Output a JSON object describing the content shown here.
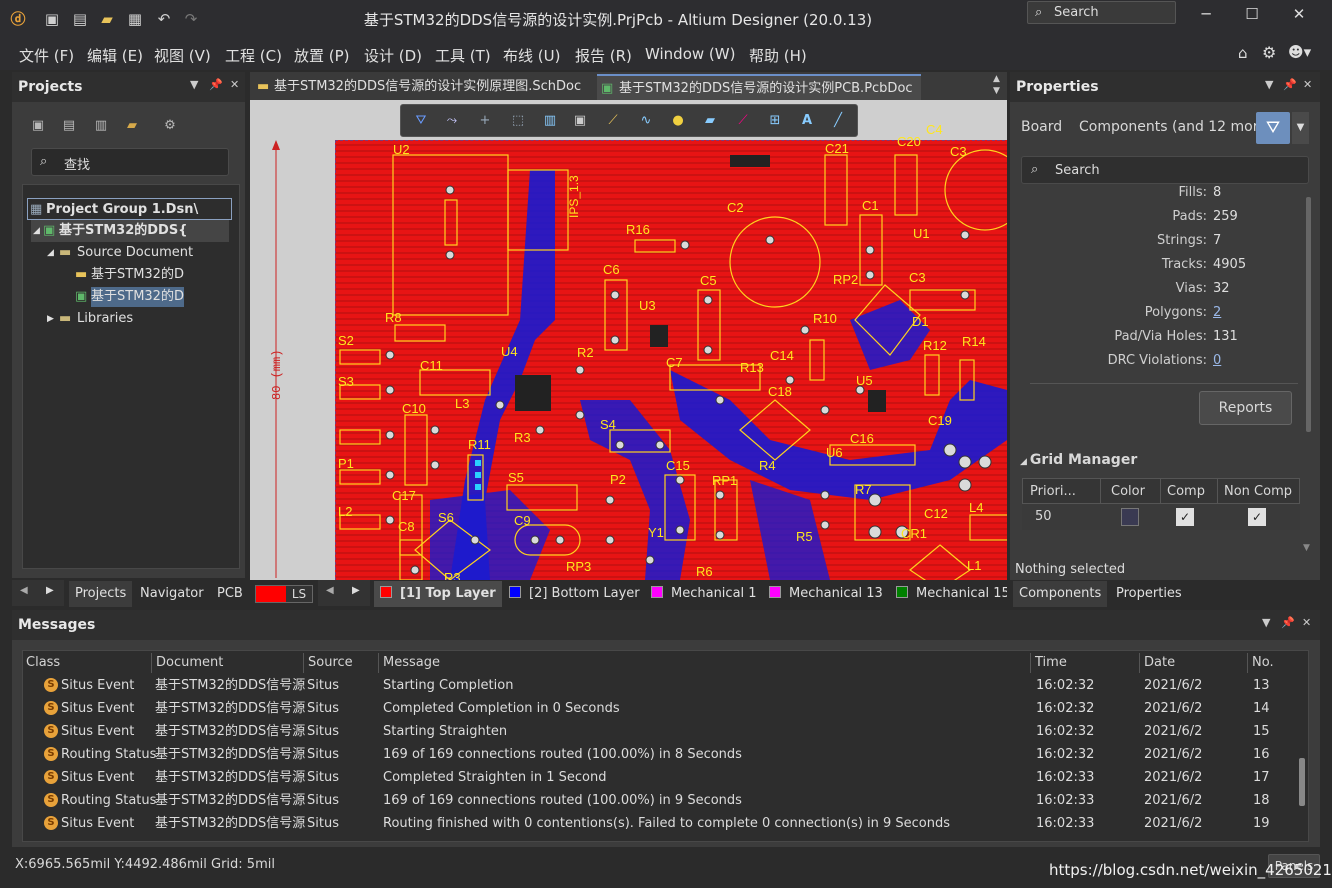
{
  "window": {
    "title": "基于STM32的DDS信号源的设计实例.PrjPcb - Altium Designer (20.0.13)",
    "search_placeholder": "Search",
    "minimize": "─",
    "maximize": "☐",
    "close": "✕"
  },
  "menu": [
    "文件 (F)",
    "编辑 (E)",
    "视图 (V)",
    "工程 (C)",
    "放置 (P)",
    "设计 (D)",
    "工具 (T)",
    "布线 (U)",
    "报告 (R)",
    "Window (W)",
    "帮助 (H)"
  ],
  "projects_panel": {
    "title": "Projects",
    "search_placeholder": "查找",
    "tree": [
      {
        "label": "Project Group 1.Dsn\\",
        "level": 0,
        "icon": "project-group-icon"
      },
      {
        "label": "基于STM32的DDS{",
        "level": 1,
        "icon": "pcb-project-icon"
      },
      {
        "label": "Source Document",
        "level": 2,
        "icon": "folder-icon"
      },
      {
        "label": "基于STM32的D",
        "level": 3,
        "icon": "schematic-doc-icon"
      },
      {
        "label": "基于STM32的D",
        "level": 3,
        "icon": "pcb-doc-icon"
      },
      {
        "label": "Libraries",
        "level": 2,
        "icon": "folder-icon"
      }
    ],
    "bottom_tabs": [
      "Projects",
      "Navigator",
      "PCB",
      "LS"
    ]
  },
  "documents": {
    "tabs": [
      {
        "label": "基于STM32的DDS信号源的设计实例原理图.SchDoc",
        "active": false
      },
      {
        "label": "基于STM32的DDS信号源的设计实例PCB.PcbDoc",
        "active": true
      }
    ],
    "ruler_label": "80 (mm)",
    "layer_tabs": [
      {
        "label": "[1] Top Layer",
        "color": "#ff0000",
        "active": true
      },
      {
        "label": "[2] Bottom Layer",
        "color": "#0000ff",
        "active": false
      },
      {
        "label": "Mechanical 1",
        "color": "#ff00ff",
        "active": false
      },
      {
        "label": "Mechanical 13",
        "color": "#ff00ff",
        "active": false
      },
      {
        "label": "Mechanical 15",
        "color": "#008000",
        "active": false
      }
    ],
    "pcb_labels": [
      "U2",
      "C3",
      "C21",
      "C20",
      "C4",
      "C2",
      "C1",
      "R16",
      "U1",
      "C6",
      "C5",
      "U3",
      "RP2",
      "C3",
      "R8",
      "R10",
      "D1",
      "S2",
      "U4",
      "R2",
      "C7",
      "R13",
      "R12",
      "R14",
      "C11",
      "S3",
      "C18",
      "U5",
      "C10",
      "L3",
      "S4",
      "C16",
      "C19",
      "R3",
      "R11",
      "P1",
      "S5",
      "C15",
      "RP1",
      "R4",
      "U6",
      "R7",
      "P2",
      "C17",
      "L2",
      "S6",
      "C8",
      "C9",
      "Y1",
      "R5",
      "CR1",
      "C12",
      "L4",
      "RP3",
      "R6",
      "R3",
      "L1",
      "C14"
    ],
    "pcb_text": "IPS_1.3"
  },
  "properties_panel": {
    "title": "Properties",
    "board_label": "Board",
    "filter_label": "Components (and 12 more)",
    "search_placeholder": "Search",
    "rows": [
      {
        "key": "Fills:",
        "value": "8",
        "link": false
      },
      {
        "key": "Pads:",
        "value": "259",
        "link": false
      },
      {
        "key": "Strings:",
        "value": "7",
        "link": false
      },
      {
        "key": "Tracks:",
        "value": "4905",
        "link": false
      },
      {
        "key": "Vias:",
        "value": "32",
        "link": false
      },
      {
        "key": "Polygons:",
        "value": "2",
        "link": true
      },
      {
        "key": "Pad/Via Holes:",
        "value": "131",
        "link": false
      },
      {
        "key": "DRC Violations:",
        "value": "0",
        "link": true
      }
    ],
    "reports_button": "Reports",
    "grid_manager": {
      "title": "Grid Manager",
      "columns": [
        "Priori...",
        "Color",
        "Comp",
        "Non Comp"
      ],
      "rows": [
        {
          "priority": "50",
          "comp": true,
          "non_comp": true
        }
      ]
    },
    "status": "Nothing selected",
    "bottom_tabs": [
      "Components",
      "Properties"
    ]
  },
  "messages_panel": {
    "title": "Messages",
    "columns": [
      "Class",
      "Document",
      "Source",
      "Message",
      "Time",
      "Date",
      "No."
    ],
    "rows": [
      {
        "class": "Situs Event",
        "document": "基于STM32的DDS信号源",
        "source": "Situs",
        "message": "Starting Completion",
        "time": "16:02:32",
        "date": "2021/6/2",
        "no": "13"
      },
      {
        "class": "Situs Event",
        "document": "基于STM32的DDS信号源",
        "source": "Situs",
        "message": "Completed Completion in 0 Seconds",
        "time": "16:02:32",
        "date": "2021/6/2",
        "no": "14"
      },
      {
        "class": "Situs Event",
        "document": "基于STM32的DDS信号源",
        "source": "Situs",
        "message": "Starting Straighten",
        "time": "16:02:32",
        "date": "2021/6/2",
        "no": "15"
      },
      {
        "class": "Routing Status",
        "document": "基于STM32的DDS信号源",
        "source": "Situs",
        "message": "169 of 169 connections routed (100.00%) in 8 Seconds",
        "time": "16:02:32",
        "date": "2021/6/2",
        "no": "16"
      },
      {
        "class": "Situs Event",
        "document": "基于STM32的DDS信号源",
        "source": "Situs",
        "message": "Completed Straighten in 1 Second",
        "time": "16:02:33",
        "date": "2021/6/2",
        "no": "17"
      },
      {
        "class": "Routing Status",
        "document": "基于STM32的DDS信号源",
        "source": "Situs",
        "message": "169 of 169 connections routed (100.00%) in 9 Seconds",
        "time": "16:02:33",
        "date": "2021/6/2",
        "no": "18"
      },
      {
        "class": "Situs Event",
        "document": "基于STM32的DDS信号源",
        "source": "Situs",
        "message": "Routing finished  with 0 contentions(s). Failed to complete 0 connection(s) in 9 Seconds",
        "time": "16:02:33",
        "date": "2021/6/2",
        "no": "19"
      }
    ]
  },
  "statusbar": {
    "coords": "X:6965.565mil Y:4492.486mil",
    "grid": "Grid: 5mil",
    "watermark": "https://blog.csdn.net/weixin_42650213",
    "panels_button": "Panels"
  }
}
